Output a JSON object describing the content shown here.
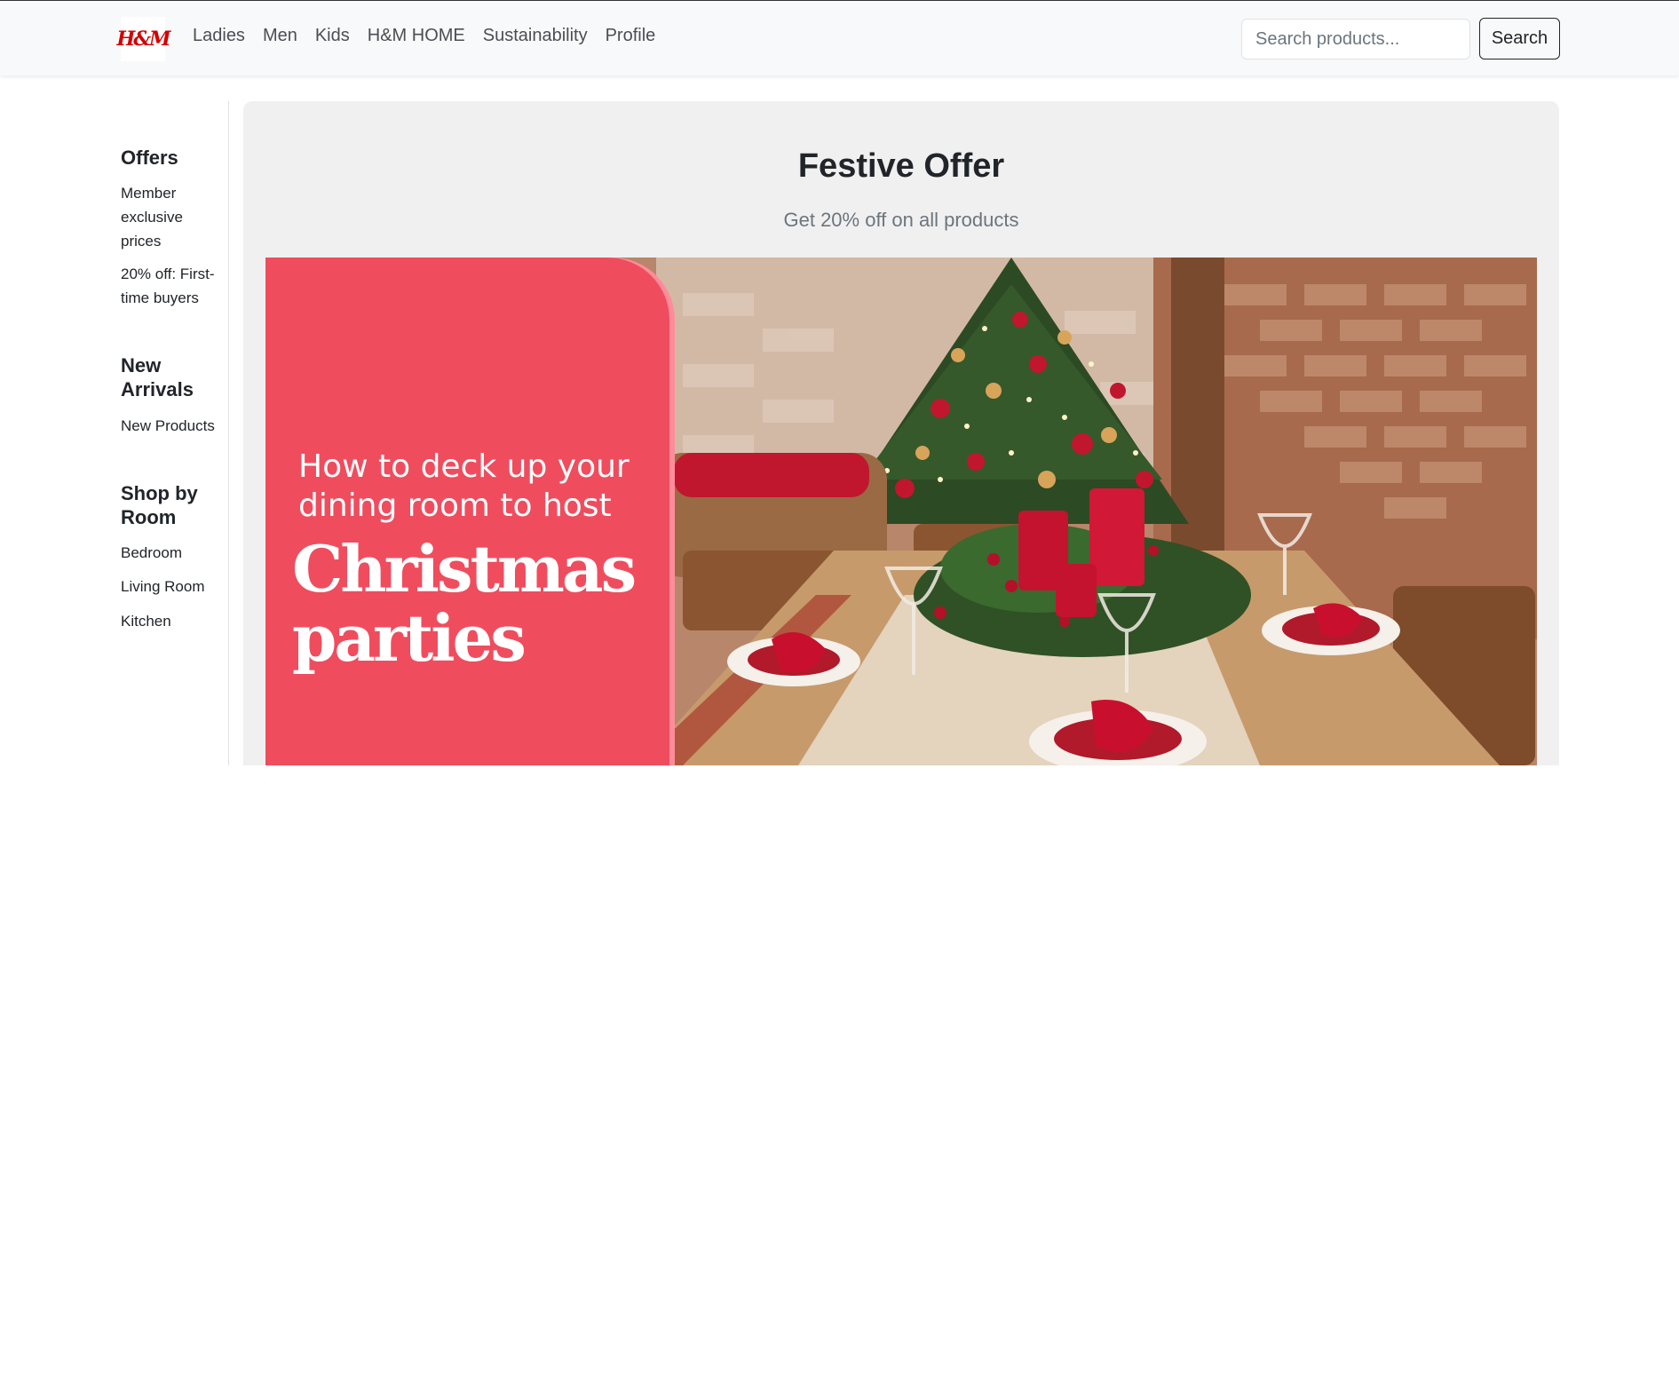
{
  "navbar": {
    "brand": "H&M",
    "links": [
      "Ladies",
      "Men",
      "Kids",
      "H&M HOME",
      "Sustainability",
      "Profile"
    ],
    "search_placeholder": "Search products...",
    "search_button": "Search"
  },
  "sidebar": {
    "sections": [
      {
        "heading": "Offers",
        "links": [
          "Member exclusive prices",
          "20% off: First-time buyers"
        ]
      },
      {
        "heading": "New Arrivals",
        "links": [
          "New Products"
        ]
      },
      {
        "heading": "Shop by Room",
        "links": [
          "Bedroom",
          "Living Room",
          "Kitchen"
        ]
      }
    ]
  },
  "main": {
    "title": "Festive Offer",
    "subtitle": "Get 20% off on all products",
    "banner": {
      "line1": "How to deck up your dining room to host",
      "line2": "Christmas parties",
      "accent_color": "#ef4d5e"
    }
  }
}
